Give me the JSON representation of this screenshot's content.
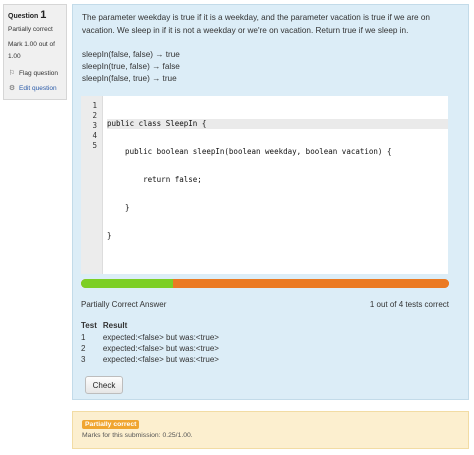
{
  "info": {
    "question_label": "Question",
    "question_number": "1",
    "state": "Partially correct",
    "grade": "Mark 1.00 out of 1.00",
    "flag_label": "Flag question",
    "edit_label": "Edit question"
  },
  "question": {
    "prompt": "The parameter weekday is true if it is a weekday, and the parameter vacation is true if we are on vacation. We sleep in if it is not a weekday or we're on vacation. Return true if we sleep in.",
    "examples": [
      "sleepIn(false, false) → true",
      "sleepIn(true, false) → false",
      "sleepIn(false, true) → true"
    ]
  },
  "editor": {
    "line_numbers": [
      "1",
      "2",
      "3",
      "4",
      "5"
    ],
    "lines": [
      "public class SleepIn {",
      "    public boolean sleepIn(boolean weekday, boolean vacation) {",
      "        return false;",
      "    }",
      "}"
    ]
  },
  "progress": {
    "passed": 1,
    "total": 4,
    "pass_color": "#7ccf25",
    "fail_color": "#eb7a23"
  },
  "summary": {
    "status": "Partially Correct Answer",
    "tests": "1 out of 4 tests correct"
  },
  "results": {
    "headers": [
      "Test",
      "Result"
    ],
    "rows": [
      {
        "test": "1",
        "result": "expected:<false> but was:<true>"
      },
      {
        "test": "2",
        "result": "expected:<false> but was:<true>"
      },
      {
        "test": "3",
        "result": "expected:<false> but was:<true>"
      }
    ]
  },
  "check_label": "Check",
  "outcome": {
    "badge": "Partially correct",
    "marks": "Marks for this submission: 0.25/1.00."
  }
}
